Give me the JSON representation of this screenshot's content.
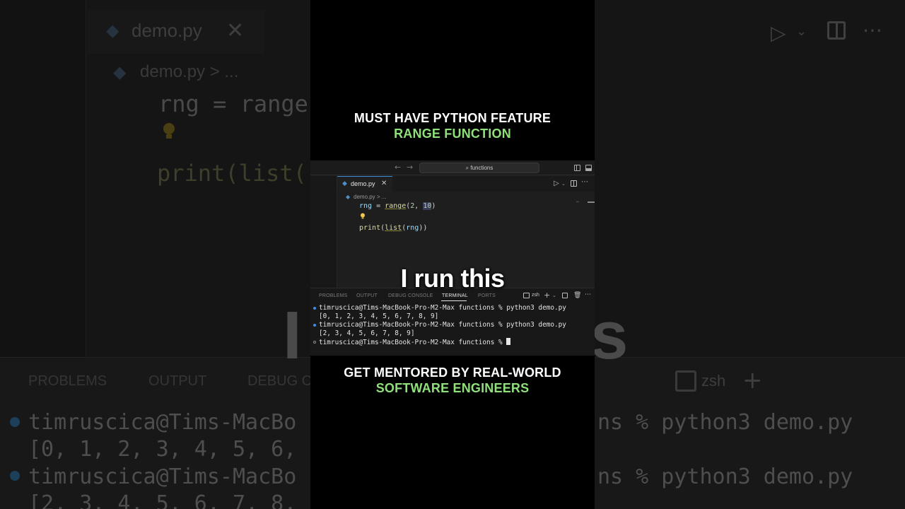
{
  "background": {
    "tab_label": "demo.py",
    "breadcrumb": "demo.py > ...",
    "code_line1": "rng = range",
    "code_line2": "print(list(",
    "panel_tabs": [
      "PROBLEMS",
      "OUTPUT",
      "DEBUG C"
    ],
    "terminal_lines": [
      "timruscica@Tims-MacBo",
      "[0, 1, 2, 3, 4, 5, 6,",
      "timruscica@Tims-MacBo",
      "[2, 3, 4, 5, 6, 7, 8,"
    ],
    "terminal_lines_right": [
      "ns % python3 demo.py",
      "ns % python3 demo.py"
    ],
    "shell_label": "zsh",
    "big_letters": [
      "I",
      "s"
    ]
  },
  "header": {
    "line1": "MUST HAVE PYTHON FEATURE",
    "line2": "RANGE FUNCTION"
  },
  "editor": {
    "search": "functions",
    "tab_label": "demo.py",
    "breadcrumb": "demo.py > ...",
    "code": {
      "line1_var": "rng",
      "line1_op": " = ",
      "line1_fn": "range",
      "line1_open": "(",
      "line1_arg1": "2",
      "line1_sep": ", ",
      "line1_arg2": "10",
      "line1_close": ")",
      "line2_fn": "print",
      "line2_open": "(",
      "line2_inner_fn": "list",
      "line2_inner_open": "(",
      "line2_var": "rng",
      "line2_close": "))"
    }
  },
  "panel": {
    "tabs": [
      "PROBLEMS",
      "OUTPUT",
      "DEBUG CONSOLE",
      "TERMINAL",
      "PORTS"
    ],
    "active_tab": "TERMINAL",
    "shell": "zsh",
    "terminal": [
      "timruscica@Tims-MacBook-Pro-M2-Max functions % python3 demo.py",
      "[0, 1, 2, 3, 4, 5, 6, 7, 8, 9]",
      "timruscica@Tims-MacBook-Pro-M2-Max functions % python3 demo.py",
      "[2, 3, 4, 5, 6, 7, 8, 9]",
      "timruscica@Tims-MacBook-Pro-M2-Max functions % "
    ]
  },
  "caption": "I run this",
  "footer": {
    "line1": "GET MENTORED BY REAL-WORLD",
    "line2": "SOFTWARE ENGINEERS"
  },
  "colors": {
    "accent_green": "#8fe07a",
    "tab_accent": "#3c8dd6",
    "terminal_dot": "#3b8eea"
  }
}
